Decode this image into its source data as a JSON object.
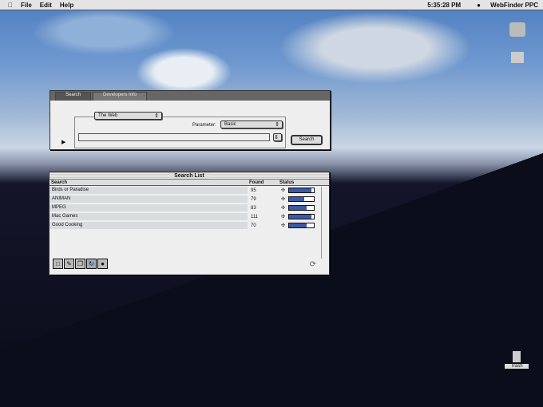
{
  "menubar": {
    "apple": "",
    "items": [
      "File",
      "Edit",
      "Help"
    ],
    "clock": "5:35:28 PM",
    "app": "WebFinder PPC"
  },
  "search_window": {
    "tabs": [
      "Search",
      "Developers Info"
    ],
    "source": "The Web",
    "parameter_label": "Parameter:",
    "parameter_value": "Basic",
    "query": "",
    "search_button": "Search"
  },
  "search_list": {
    "title": "Search List",
    "columns": [
      "Search",
      "Found",
      "Status"
    ],
    "rows": [
      {
        "name": "Birds or Paradise",
        "found": "95",
        "progress": 0.9
      },
      {
        "name": "ANIMAN",
        "found": "79",
        "progress": 0.62
      },
      {
        "name": "MPEG",
        "found": "83",
        "progress": 0.72
      },
      {
        "name": "Mac Games",
        "found": "111",
        "progress": 0.9
      },
      {
        "name": "Good Cooking",
        "found": "70",
        "progress": 0.72
      }
    ]
  },
  "desktop": {
    "trash": "Trash"
  }
}
